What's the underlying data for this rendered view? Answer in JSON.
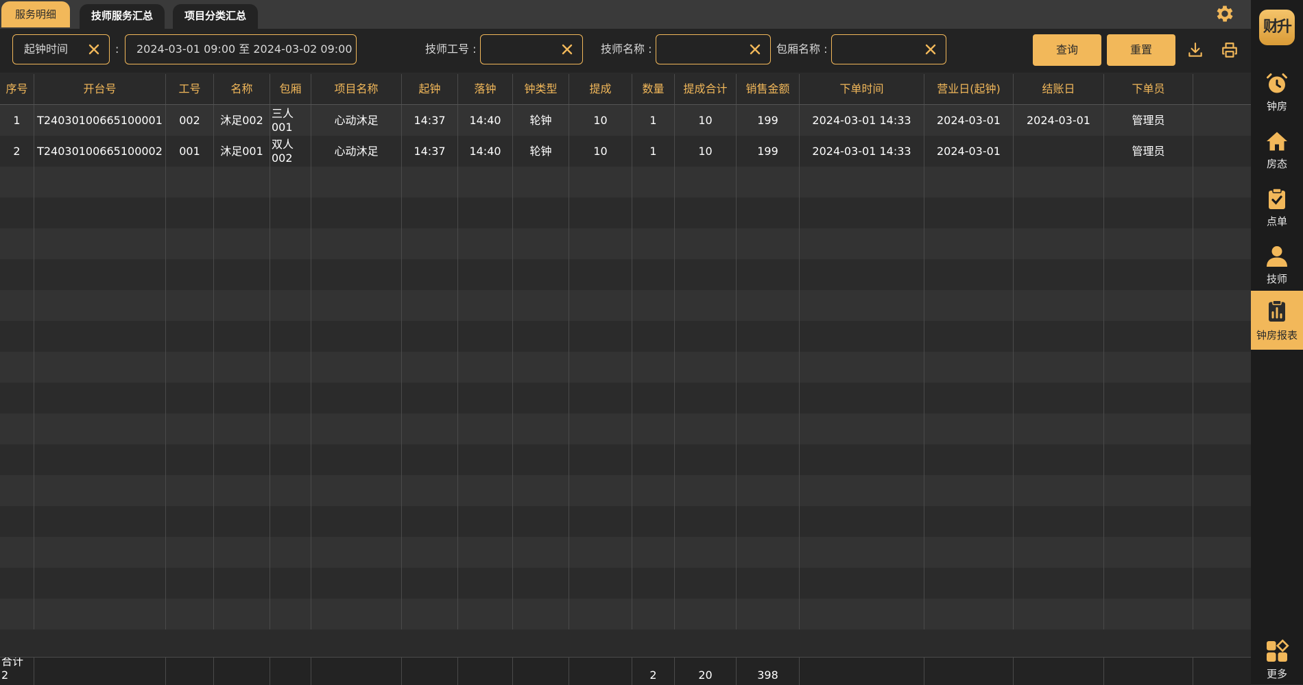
{
  "tabs": [
    {
      "label": "服务明细",
      "active": true
    },
    {
      "label": "技师服务汇总",
      "active": false
    },
    {
      "label": "项目分类汇总",
      "active": false
    }
  ],
  "filters": {
    "time_type": "起钟时间",
    "colon": ":",
    "date_range": "2024-03-01 09:00 至 2024-03-02 09:00",
    "tech_no_label": "技师工号 :",
    "tech_no_value": "",
    "tech_name_label": "技师名称 :",
    "tech_name_value": "",
    "room_name_label": "包厢名称 :",
    "room_name_value": "",
    "query_label": "查询",
    "reset_label": "重置"
  },
  "table": {
    "headers": [
      "序号",
      "开台号",
      "工号",
      "名称",
      "包厢",
      "项目名称",
      "起钟",
      "落钟",
      "钟类型",
      "提成",
      "数量",
      "提成合计",
      "销售金额",
      "下单时间",
      "营业日(起钟)",
      "结账日",
      "下单员",
      ""
    ],
    "rows": [
      [
        "1",
        "T24030100665100001",
        "002",
        "沐足002",
        "三人001",
        "心动沐足",
        "14:37",
        "14:40",
        "轮钟",
        "10",
        "1",
        "10",
        "199",
        "2024-03-01 14:33",
        "2024-03-01",
        "2024-03-01",
        "管理员",
        ""
      ],
      [
        "2",
        "T24030100665100002",
        "001",
        "沐足001",
        "双人002",
        "心动沐足",
        "14:37",
        "14:40",
        "轮钟",
        "10",
        "1",
        "10",
        "199",
        "2024-03-01 14:33",
        "2024-03-01",
        "",
        "管理员",
        ""
      ]
    ],
    "total": [
      "合计 2",
      "",
      "",
      "",
      "",
      "",
      "",
      "",
      "",
      "",
      "2",
      "20",
      "398",
      "",
      "",
      "",
      "",
      ""
    ]
  },
  "sidebar": {
    "logo": "财升",
    "items": [
      {
        "label": "钟房",
        "icon": "alarm-clock-icon",
        "active": false
      },
      {
        "label": "房态",
        "icon": "home-icon",
        "active": false
      },
      {
        "label": "点单",
        "icon": "clipboard-check-icon",
        "active": false
      },
      {
        "label": "技师",
        "icon": "person-icon",
        "active": false
      },
      {
        "label": "钟房报表",
        "icon": "report-chart-icon",
        "active": true
      }
    ],
    "more_label": "更多"
  },
  "colors": {
    "accent": "#f2b85a",
    "background": "#2b2b2b",
    "sidebar": "#1c1c1c"
  }
}
